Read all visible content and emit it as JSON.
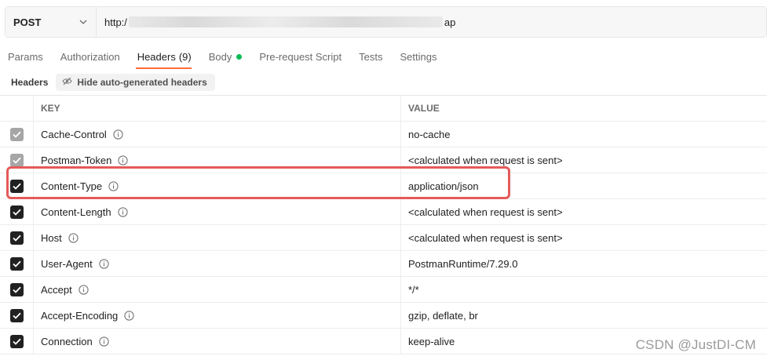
{
  "request": {
    "method": "POST",
    "url_prefix": "http:/",
    "url_suffix": "ap"
  },
  "tabs": [
    {
      "label": "Params"
    },
    {
      "label": "Authorization"
    },
    {
      "label": "Headers",
      "count": "(9)"
    },
    {
      "label": "Body"
    },
    {
      "label": "Pre-request Script"
    },
    {
      "label": "Tests"
    },
    {
      "label": "Settings"
    }
  ],
  "headers_bar": {
    "title": "Headers",
    "hide_label": "Hide auto-generated headers"
  },
  "table": {
    "key_header": "KEY",
    "value_header": "VALUE",
    "rows": [
      {
        "key": "Cache-Control",
        "value": "no-cache",
        "checked": true,
        "auto": true
      },
      {
        "key": "Postman-Token",
        "value": "<calculated when request is sent>",
        "checked": true,
        "auto": true
      },
      {
        "key": "Content-Type",
        "value": "application/json",
        "checked": true,
        "auto": false
      },
      {
        "key": "Content-Length",
        "value": "<calculated when request is sent>",
        "checked": true,
        "auto": false
      },
      {
        "key": "Host",
        "value": "<calculated when request is sent>",
        "checked": true,
        "auto": false
      },
      {
        "key": "User-Agent",
        "value": "PostmanRuntime/7.29.0",
        "checked": true,
        "auto": false
      },
      {
        "key": "Accept",
        "value": "*/*",
        "checked": true,
        "auto": false
      },
      {
        "key": "Accept-Encoding",
        "value": "gzip, deflate, br",
        "checked": true,
        "auto": false
      },
      {
        "key": "Connection",
        "value": "keep-alive",
        "checked": true,
        "auto": false
      }
    ]
  },
  "watermark": "CSDN @JustDI-CM",
  "colors": {
    "accent": "#ff6c37",
    "body_dot": "#0cbb52",
    "highlight": "#e55a5a"
  },
  "icons": {
    "method_dropdown": "chevron-down-icon",
    "info": "info-icon",
    "hide": "eye-off-icon",
    "checkbox": "check-icon"
  }
}
